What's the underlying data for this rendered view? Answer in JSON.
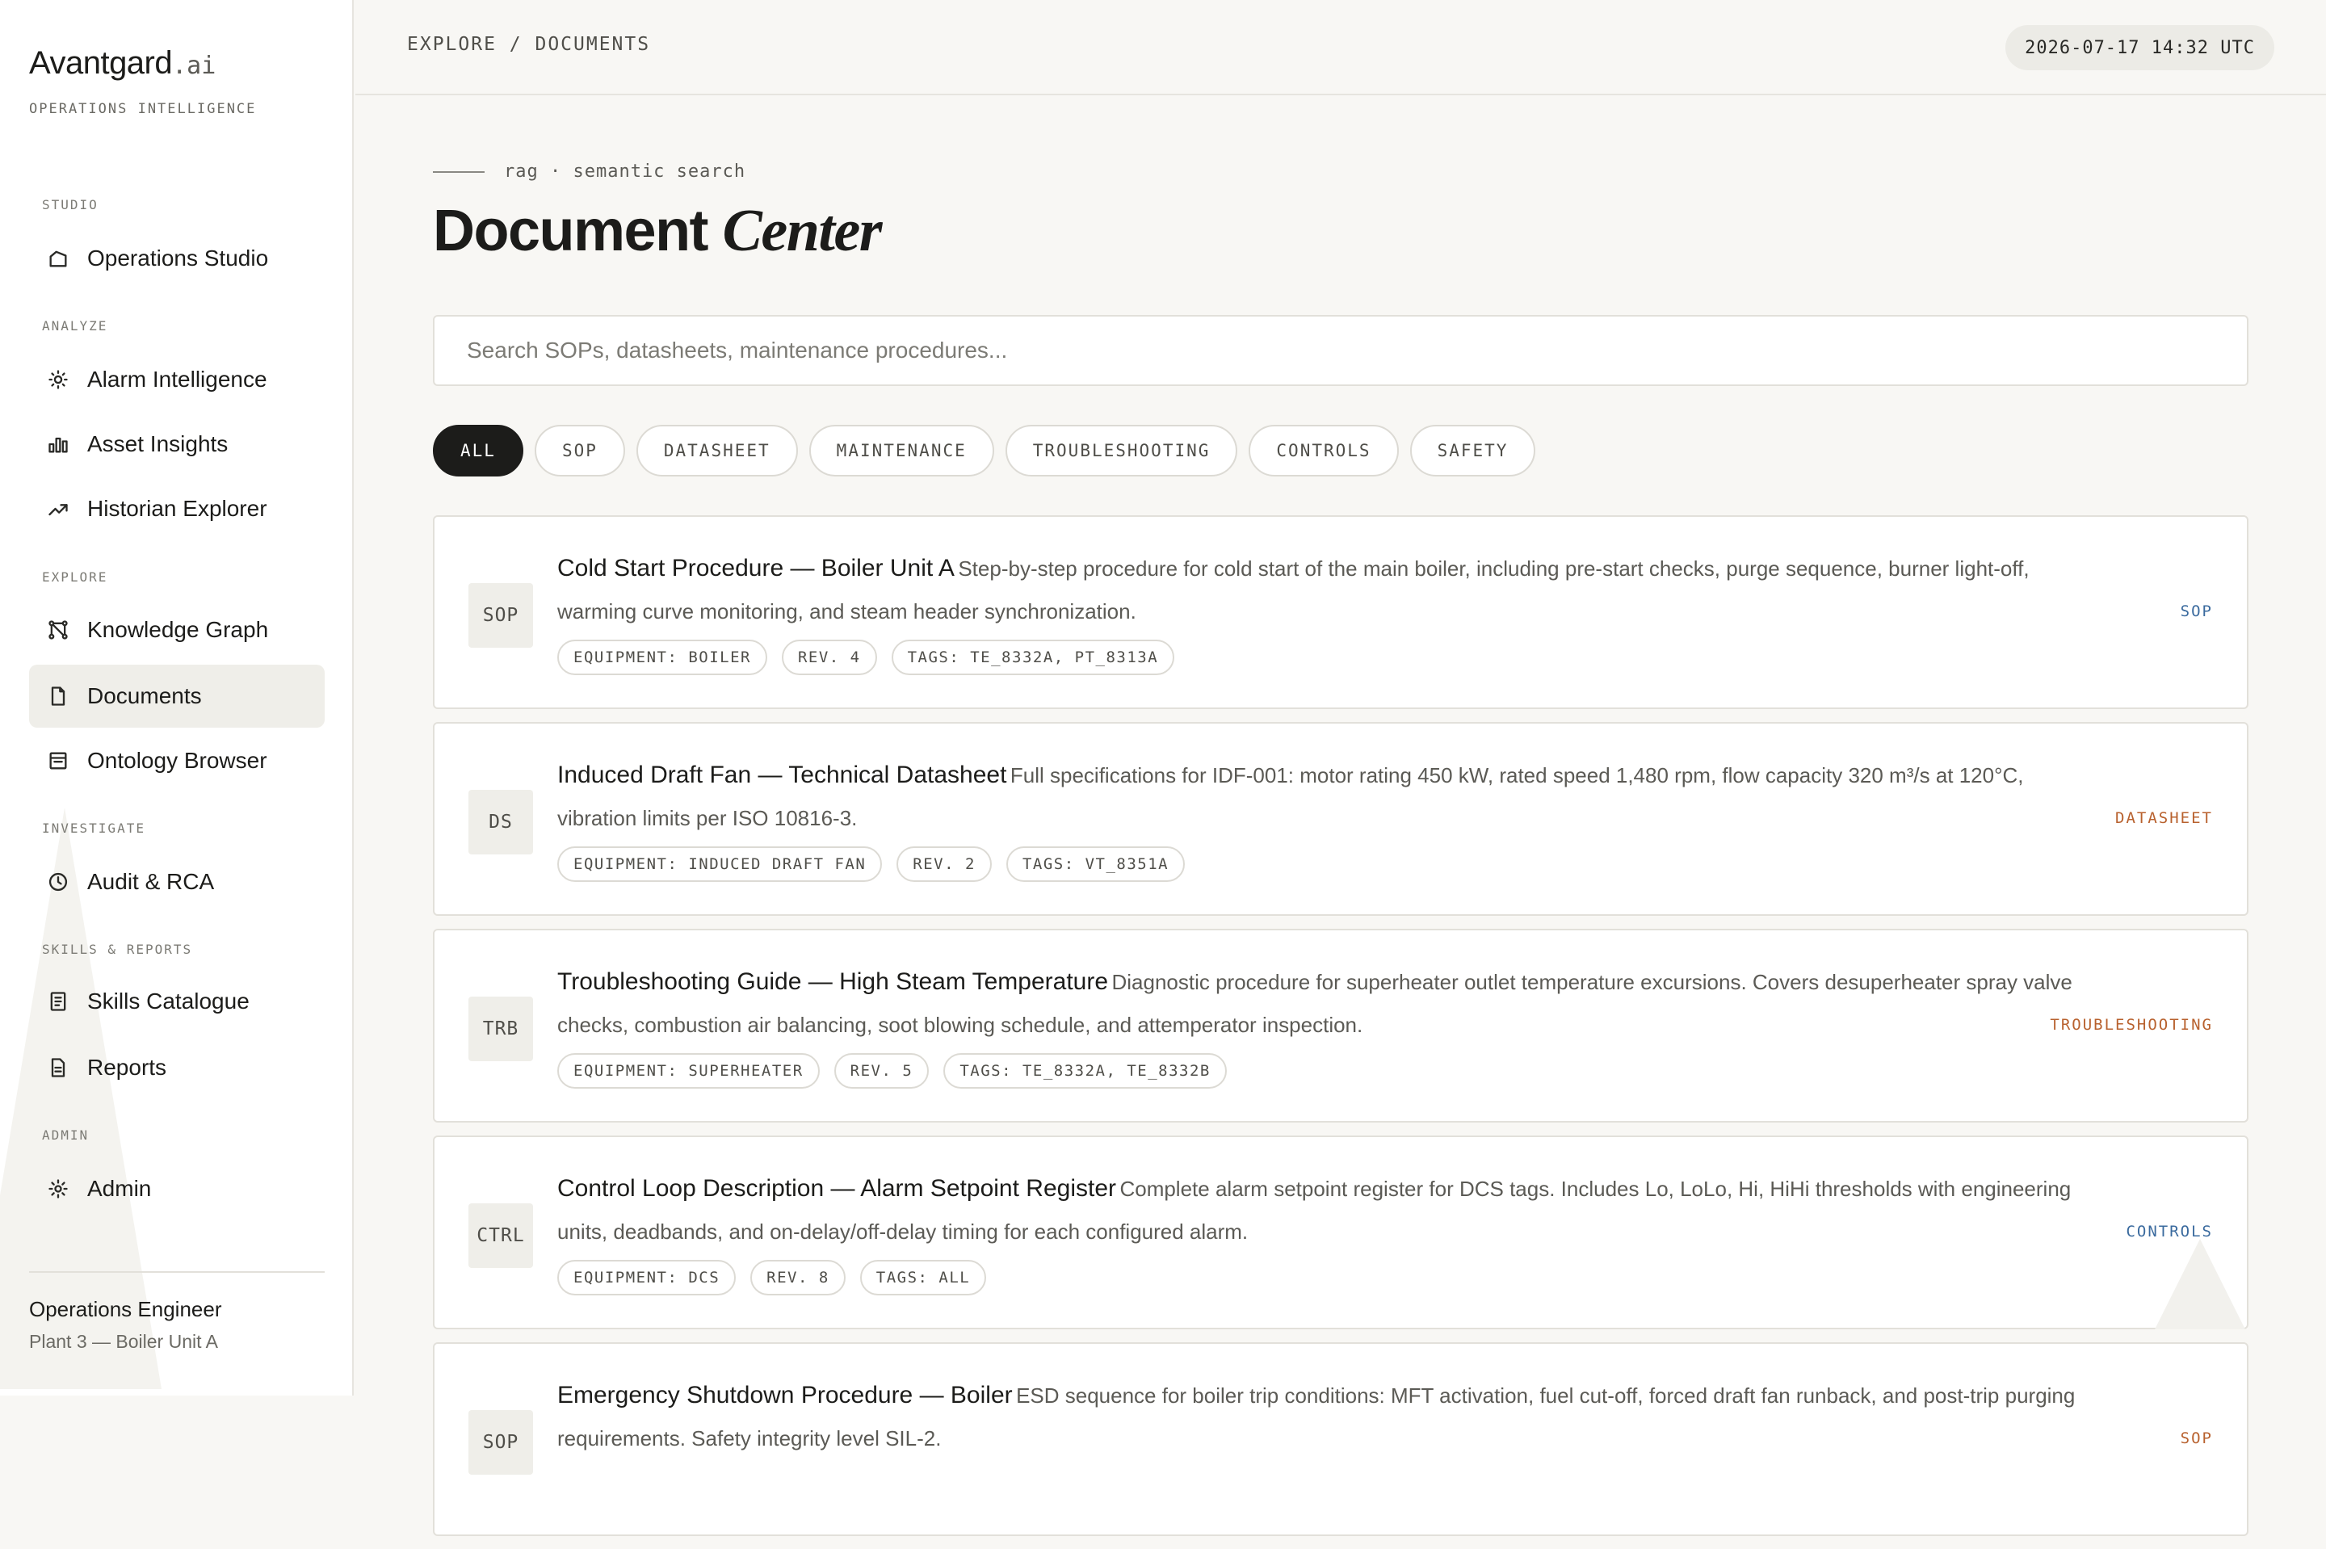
{
  "brand": {
    "name": "Avantgard",
    "suffix": ".ai",
    "tagline": "OPERATIONS INTELLIGENCE"
  },
  "sidebar": {
    "groups": [
      {
        "label": "STUDIO",
        "items": [
          {
            "label": "Operations Studio",
            "icon": "home-icon"
          }
        ]
      },
      {
        "label": "ANALYZE",
        "items": [
          {
            "label": "Alarm Intelligence",
            "icon": "sun-icon"
          },
          {
            "label": "Asset Insights",
            "icon": "bar-chart-icon"
          },
          {
            "label": "Historian Explorer",
            "icon": "trend-line-icon"
          }
        ]
      },
      {
        "label": "EXPLORE",
        "items": [
          {
            "label": "Knowledge Graph",
            "icon": "graph-nodes-icon"
          },
          {
            "label": "Documents",
            "icon": "document-icon",
            "active": true
          },
          {
            "label": "Ontology Browser",
            "icon": "browser-window-icon"
          }
        ]
      },
      {
        "label": "INVESTIGATE",
        "items": [
          {
            "label": "Audit & RCA",
            "icon": "clock-icon"
          }
        ]
      },
      {
        "label": "SKILLS & REPORTS",
        "items": [
          {
            "label": "Skills Catalogue",
            "icon": "catalogue-icon"
          },
          {
            "label": "Reports",
            "icon": "report-icon"
          }
        ]
      },
      {
        "label": "ADMIN",
        "items": [
          {
            "label": "Admin",
            "icon": "gear-icon"
          }
        ]
      }
    ]
  },
  "user": {
    "role": "Operations Engineer",
    "site": "Plant 3 — Boiler Unit A"
  },
  "header": {
    "breadcrumb": "EXPLORE / DOCUMENTS",
    "timestamp": "2026-07-17 14:32 UTC"
  },
  "page": {
    "eyebrow": "rag · semantic search",
    "title_main": "Document",
    "title_italic": "Center",
    "search_placeholder": "Search SOPs, datasheets, maintenance procedures..."
  },
  "filters": [
    "ALL",
    "SOP",
    "DATASHEET",
    "MAINTENANCE",
    "TROUBLESHOOTING",
    "CONTROLS",
    "SAFETY"
  ],
  "active_filter": "ALL",
  "colors": {
    "sop": "#3a6a9e",
    "datasheet": "#b8612e",
    "troubleshooting": "#b8612e",
    "controls": "#3a6a9e",
    "active_chip": "#1c1c1a"
  },
  "documents": [
    {
      "badge": "SOP",
      "title": "Cold Start Procedure — Boiler Unit A",
      "description": "Step-by-step procedure for cold start of the main boiler, including pre-start checks, purge sequence, burner light-off, warming curve monitoring, and steam header synchronization.",
      "equipment": "EQUIPMENT: BOILER",
      "revision": "REV. 4",
      "tags": "TAGS: TE_8332A, PT_8313A",
      "type": "SOP",
      "type_color": "#3a6a9e"
    },
    {
      "badge": "DS",
      "title": "Induced Draft Fan — Technical Datasheet",
      "description": "Full specifications for IDF-001: motor rating 450 kW, rated speed 1,480 rpm, flow capacity 320 m³/s at 120°C, vibration limits per ISO 10816-3.",
      "equipment": "EQUIPMENT: INDUCED DRAFT FAN",
      "revision": "REV. 2",
      "tags": "TAGS: VT_8351A",
      "type": "DATASHEET",
      "type_color": "#b8612e"
    },
    {
      "badge": "TRB",
      "title": "Troubleshooting Guide — High Steam Temperature",
      "description": "Diagnostic procedure for superheater outlet temperature excursions. Covers desuperheater spray valve checks, combustion air balancing, soot blowing schedule, and attemperator inspection.",
      "equipment": "EQUIPMENT: SUPERHEATER",
      "revision": "REV. 5",
      "tags": "TAGS: TE_8332A, TE_8332B",
      "type": "TROUBLESHOOTING",
      "type_color": "#b8612e"
    },
    {
      "badge": "CTRL",
      "title": "Control Loop Description — Alarm Setpoint Register",
      "description": "Complete alarm setpoint register for DCS tags. Includes Lo, LoLo, Hi, HiHi thresholds with engineering units, deadbands, and on-delay/off-delay timing for each configured alarm.",
      "equipment": "EQUIPMENT: DCS",
      "revision": "REV. 8",
      "tags": "TAGS: ALL",
      "type": "CONTROLS",
      "type_color": "#3a6a9e"
    },
    {
      "badge": "SOP",
      "title": "Emergency Shutdown Procedure — Boiler",
      "description": "ESD sequence for boiler trip conditions: MFT activation, fuel cut-off, forced draft fan runback, and post-trip purging requirements. Safety integrity level SIL-2.",
      "equipment": "",
      "revision": "",
      "tags": "",
      "type": "SOP",
      "type_color": "#b8612e"
    }
  ]
}
